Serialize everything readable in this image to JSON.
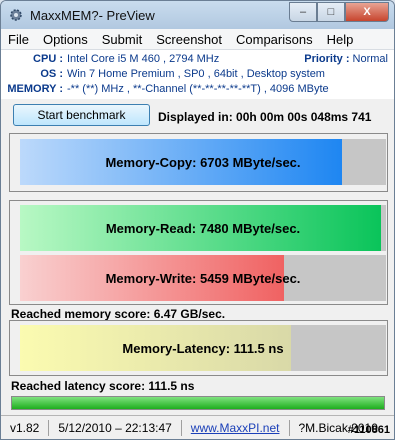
{
  "window": {
    "title": "MaxxMEM?- PreView",
    "buttons": {
      "minimize": "–",
      "maximize": "□",
      "close": "X"
    }
  },
  "menu": [
    "File",
    "Options",
    "Submit",
    "Screenshot",
    "Comparisons",
    "Help"
  ],
  "info": {
    "cpu_label": "CPU :",
    "cpu_value": "Intel Core i5 M 460  ,  2794 MHz",
    "priority_label": "Priority :",
    "priority_value": "Normal",
    "os_label": "OS :",
    "os_value": "Win 7 Home Premium  ,  SP0  ,  64bit  ,  Desktop system",
    "memory_label": "MEMORY :",
    "memory_value": "-** (**) MHz  ,  **-Channel  (**-**-**-**-**T)  ,  4096 MByte"
  },
  "benchmark": {
    "button": "Start benchmark",
    "displayed_in": "Displayed in: 00h 00m 00s 048ms 741"
  },
  "bars": {
    "copy": {
      "label": "Memory-Copy: 6703 MByte/sec.",
      "fraction": 0.88
    },
    "read": {
      "label": "Memory-Read: 7480 MByte/sec.",
      "fraction": 0.985
    },
    "write": {
      "label": "Memory-Write: 5459 MByte/sec.",
      "fraction": 0.72
    },
    "latency": {
      "label": "Memory-Latency: 111.5 ns",
      "fraction": 0.74
    }
  },
  "scores": {
    "memory": "Reached memory score: 6.47 GB/sec.",
    "latency": "Reached latency score: 111.5 ns"
  },
  "latency_progress": 1.0,
  "status": {
    "version": "v1.82",
    "datetime": "5/12/2010 – 22:13:47",
    "url": "www.MaxxPI.net",
    "author": "?M.Bicak 2010"
  },
  "watermark": "#110861",
  "colors": {
    "copy": [
      "#bcd9fb",
      "#1e86f2"
    ],
    "read": [
      "#b8f8c4",
      "#0ac45a"
    ],
    "write": [
      "#f9d0d0",
      "#f06262"
    ],
    "latency": [
      "#fbfbb0",
      "#d9d9a8"
    ]
  }
}
